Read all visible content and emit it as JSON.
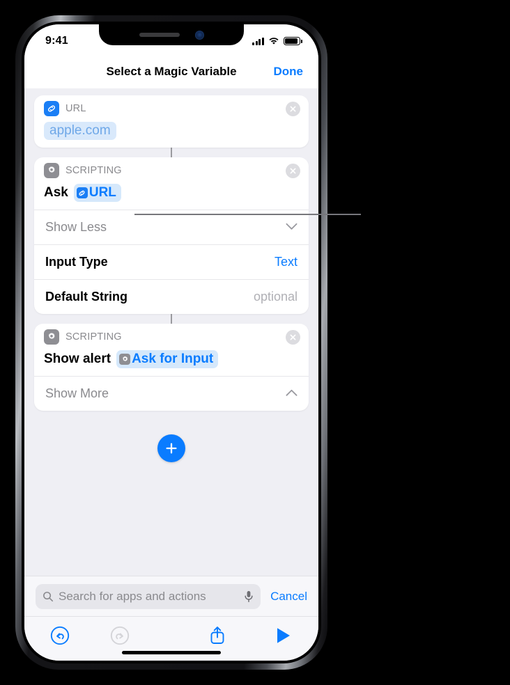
{
  "status_bar": {
    "time": "9:41",
    "signal_icon": "cellular-bars-icon",
    "wifi_icon": "wifi-icon",
    "battery_icon": "battery-full-icon"
  },
  "nav": {
    "title": "Select a Magic Variable",
    "done_label": "Done"
  },
  "cards": [
    {
      "icon": "link-icon",
      "header": "URL",
      "close_icon": "close-circle-icon",
      "value": "apple.com"
    },
    {
      "icon": "gear-icon",
      "header": "SCRIPTING",
      "close_icon": "close-circle-icon",
      "action_text": "Ask",
      "token": {
        "icon": "link-icon",
        "label": "URL"
      },
      "disclosure": {
        "label": "Show Less",
        "icon": "chevron-down-icon"
      },
      "rows": [
        {
          "label": "Input Type",
          "value": "Text"
        },
        {
          "label": "Default String",
          "value": "optional"
        }
      ]
    },
    {
      "icon": "gear-icon",
      "header": "SCRIPTING",
      "close_icon": "close-circle-icon",
      "action_text": "Show alert",
      "token": {
        "icon": "gear-icon",
        "label": "Ask for Input"
      },
      "disclosure": {
        "label": "Show More",
        "icon": "chevron-up-icon"
      }
    }
  ],
  "add_button": {
    "icon": "plus-icon"
  },
  "search": {
    "icon": "search-icon",
    "placeholder": "Search for apps and actions",
    "mic_icon": "microphone-icon",
    "cancel_label": "Cancel"
  },
  "toolbar": {
    "undo_icon": "undo-circle-icon",
    "redo_icon": "redo-circle-icon",
    "share_icon": "share-icon",
    "run_icon": "play-icon"
  },
  "colors": {
    "accent_blue": "#0a7cff",
    "icon_blue": "#1a7ef5",
    "icon_gray": "#8e8e93",
    "token_bg": "#d5e8fb",
    "value_pill_bg": "#d9e9fb",
    "value_pill_text": "#6fa8e8",
    "screen_bg": "#efeff4",
    "disabled_gray": "#d4d4d8"
  }
}
